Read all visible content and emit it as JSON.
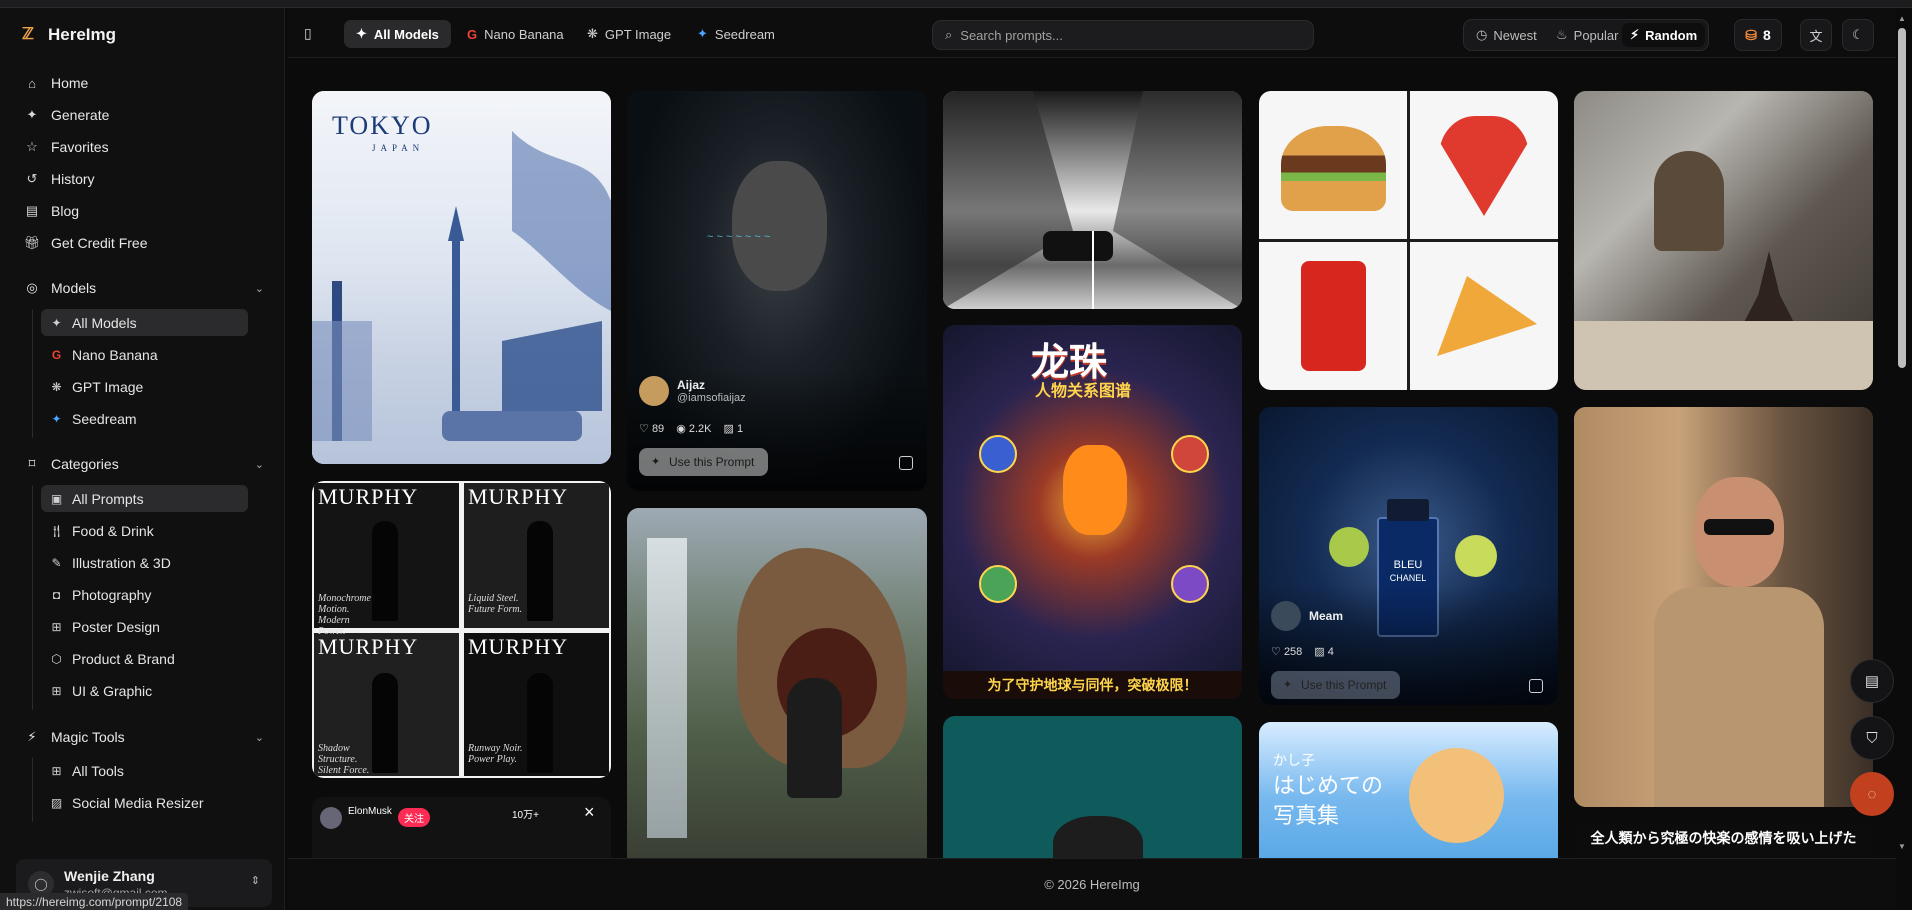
{
  "brand": {
    "name": "HereImg",
    "logo_icon": "z-logo-icon"
  },
  "sidebar": {
    "nav": [
      {
        "label": "Home",
        "icon": "home-icon"
      },
      {
        "label": "Generate",
        "icon": "sparkles-icon"
      },
      {
        "label": "Favorites",
        "icon": "star-icon"
      },
      {
        "label": "History",
        "icon": "history-icon"
      },
      {
        "label": "Blog",
        "icon": "blog-icon"
      },
      {
        "label": "Get Credit Free",
        "icon": "gift-icon"
      }
    ],
    "models": {
      "title": "Models",
      "items": [
        {
          "label": "All Models",
          "icon": "sparkles-icon",
          "active": true
        },
        {
          "label": "Nano Banana",
          "icon": "google-icon",
          "active": false
        },
        {
          "label": "GPT Image",
          "icon": "openai-icon",
          "active": false
        },
        {
          "label": "Seedream",
          "icon": "seedream-icon",
          "active": false
        }
      ]
    },
    "categories": {
      "title": "Categories",
      "items": [
        {
          "label": "All Prompts",
          "active": true
        },
        {
          "label": "Food & Drink",
          "active": false
        },
        {
          "label": "Illustration & 3D",
          "active": false
        },
        {
          "label": "Photography",
          "active": false
        },
        {
          "label": "Poster Design",
          "active": false
        },
        {
          "label": "Product & Brand",
          "active": false
        },
        {
          "label": "UI & Graphic",
          "active": false
        }
      ]
    },
    "tools": {
      "title": "Magic Tools",
      "items": [
        {
          "label": "All Tools"
        },
        {
          "label": "Social Media Resizer"
        }
      ]
    },
    "user": {
      "name": "Wenjie Zhang",
      "email": "zwjsoft@gmail.com"
    }
  },
  "status_url": "https://hereimg.com/prompt/2108",
  "header": {
    "model_tabs": [
      {
        "label": "All Models",
        "active": true
      },
      {
        "label": "Nano Banana",
        "active": false
      },
      {
        "label": "GPT Image",
        "active": false
      },
      {
        "label": "Seedream",
        "active": false
      }
    ],
    "search_placeholder": "Search prompts...",
    "sort": [
      {
        "label": "Newest",
        "active": false
      },
      {
        "label": "Popular",
        "active": false
      },
      {
        "label": "Random",
        "active": true
      }
    ],
    "credits": "8"
  },
  "cards": {
    "tokyo": {
      "title": "TOKYO",
      "subtitle": "JAPAN"
    },
    "portrait": {
      "author": "Aijaz",
      "handle": "@iamsofiaijaz",
      "likes": "89",
      "views": "2.2K",
      "images": "1",
      "use_label": "Use this Prompt"
    },
    "murphy": {
      "word": "MURPHY",
      "captions": [
        "Monochrome Motion. Modern Power.",
        "Liquid Steel. Future Form.",
        "Shadow Structure. Silent Force.",
        "Runway Noir. Power Play."
      ]
    },
    "dragonball": {
      "title": "龙珠",
      "subtitle": "人物关系图谱",
      "banner": "为了守护地球与同伴，突破极限！"
    },
    "perfume": {
      "brand_line1": "BLEU",
      "brand_line2": "CHANEL",
      "author": "Meam",
      "likes": "258",
      "images": "4",
      "use_label": "Use this Prompt"
    },
    "photobook": {
      "title": "はじめての",
      "title2": "写真集",
      "kana": "かし子"
    },
    "elon": {
      "name": "ElonMusk",
      "follow": "关注",
      "count": "10万+"
    },
    "banner_jp": "全人類から究極の快楽の感情を吸い上げた"
  },
  "footer": "© 2026 HereImg"
}
